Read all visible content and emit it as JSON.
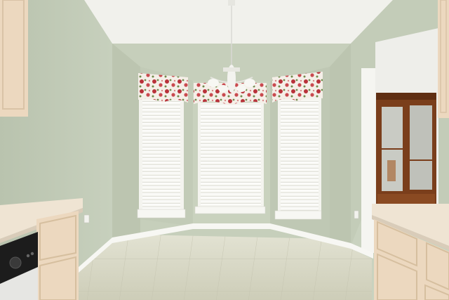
{
  "scene": {
    "description_tags": [
      "room",
      "bay-window",
      "chandelier",
      "cabinets",
      "tile-floor"
    ],
    "colors": {
      "wall": "#c4cdb9",
      "wall_shadow": "#aab4a2",
      "ceiling": "#f1f1ec",
      "window": "#fbfbf8",
      "trim": "#f7f7f3",
      "cabinet": "#ecd8bf",
      "counter": "#efe4d3",
      "floor": "#d9d8c6",
      "valance_red": "#b23a3a",
      "hutch": "#7a3e1b"
    }
  }
}
